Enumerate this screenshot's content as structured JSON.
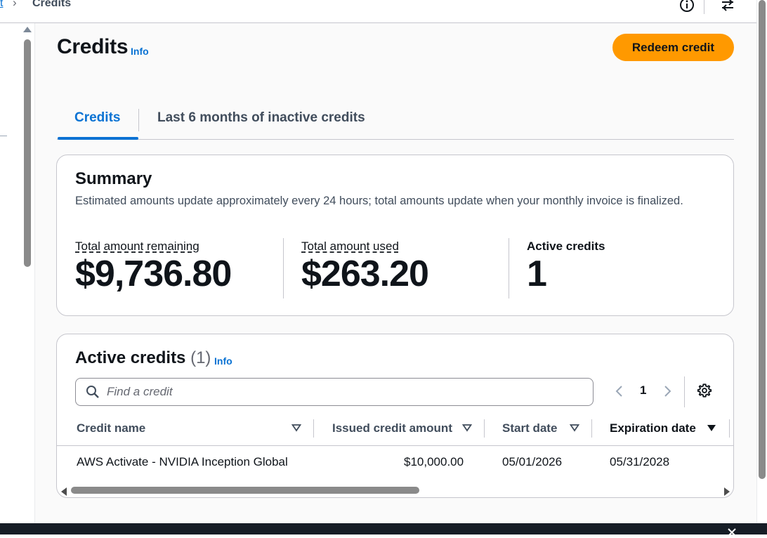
{
  "breadcrumb": {
    "parent_label": "t",
    "current_label": "Credits"
  },
  "header": {
    "title": "Credits",
    "info_label": "Info",
    "redeem_button_label": "Redeem credit"
  },
  "tabs": [
    {
      "label": "Credits",
      "active": true
    },
    {
      "label": "Last 6 months of inactive credits",
      "active": false
    }
  ],
  "summary": {
    "title": "Summary",
    "description": "Estimated amounts update approximately every 24 hours; total amounts update when your monthly invoice is finalized.",
    "metrics": [
      {
        "label": "Total amount remaining",
        "value": "$9,736.80"
      },
      {
        "label": "Total amount used",
        "value": "$263.20"
      },
      {
        "label": "Active credits",
        "value": "1"
      }
    ]
  },
  "active_credits": {
    "title": "Active credits",
    "count": "(1)",
    "info_label": "Info",
    "search_placeholder": "Find a credit",
    "pagination": {
      "current_page": "1"
    },
    "columns": [
      "Credit name",
      "Issued credit amount",
      "Start date",
      "Expiration date"
    ],
    "rows": [
      {
        "credit_name": "AWS Activate - NVIDIA Inception Global",
        "issued_amount": "$10,000.00",
        "start_date": "05/01/2026",
        "expiration_date": "05/31/2028"
      }
    ]
  },
  "icons": {
    "info": "info-circle-icon",
    "split_panel": "split-panel-icon",
    "search": "search-icon",
    "settings": "gear-icon",
    "close": "close-icon"
  },
  "colors": {
    "accent_blue": "#0972d3",
    "primary_button": "#ff9900",
    "text_dark": "#0f141a",
    "border": "#c6c6cd",
    "footer_bg": "#161d26"
  }
}
